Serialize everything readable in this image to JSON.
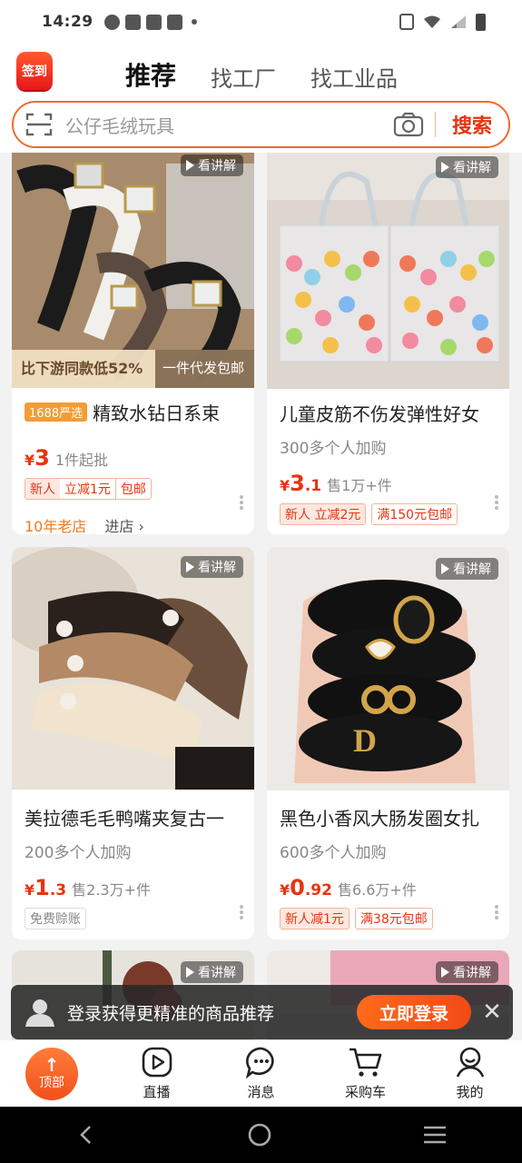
{
  "status_bar": {
    "time": "14:29"
  },
  "header": {
    "checkin_label": "签到",
    "tabs": [
      {
        "label": "推荐",
        "active": true
      },
      {
        "label": "找工厂",
        "active": false
      },
      {
        "label": "找工业品",
        "active": false
      }
    ],
    "search": {
      "placeholder": "公仔毛绒玩具",
      "button_label": "搜索"
    }
  },
  "products": [
    {
      "badge": "1688严选",
      "title": "精致水钻日系束",
      "image_overlay_left": "比下游同款低52%",
      "image_overlay_right": "一件代发包邮",
      "watch_label": "看讲解",
      "price_symbol": "¥",
      "price_int": "3",
      "price_dec": "",
      "price_extra": "1件起批",
      "promos": [
        "新人",
        "立减1元",
        "包邮"
      ],
      "shop_age": "10年老店",
      "shop_link": "进店 ›"
    },
    {
      "title": "儿童皮筋不伤发弹性好女",
      "subtitle": "300多个人加购",
      "watch_label": "看讲解",
      "price_symbol": "¥",
      "price_int": "3",
      "price_dec": ".1",
      "price_extra": "售1万+件",
      "promos": [
        "新人 立减2元",
        "满150元包邮"
      ]
    },
    {
      "title": "美拉德毛毛鸭嘴夹复古一",
      "subtitle": "200多个人加购",
      "watch_label": "看讲解",
      "price_symbol": "¥",
      "price_int": "1",
      "price_dec": ".3",
      "price_extra": "售2.3万+件",
      "promos": [
        "免费赊账"
      ]
    },
    {
      "title": "黑色小香风大肠发圈女扎",
      "subtitle": "600多个人加购",
      "watch_label": "看讲解",
      "price_symbol": "¥",
      "price_int": "0",
      "price_dec": ".92",
      "price_extra": "售6.6万+件",
      "promos": [
        "新人减1元",
        "满38元包邮"
      ]
    },
    {
      "watch_label": "看讲解"
    },
    {
      "watch_label": "看讲解"
    }
  ],
  "login_banner": {
    "text": "登录获得更精准的商品推荐",
    "button": "立即登录"
  },
  "bottom_nav": {
    "top_button": "顶部",
    "items": [
      "直播",
      "消息",
      "采购车",
      "我的"
    ]
  },
  "colors": {
    "accent": "#e8330f",
    "brand_orange": "#f26a2a",
    "shop_age": "#f07a1e"
  }
}
